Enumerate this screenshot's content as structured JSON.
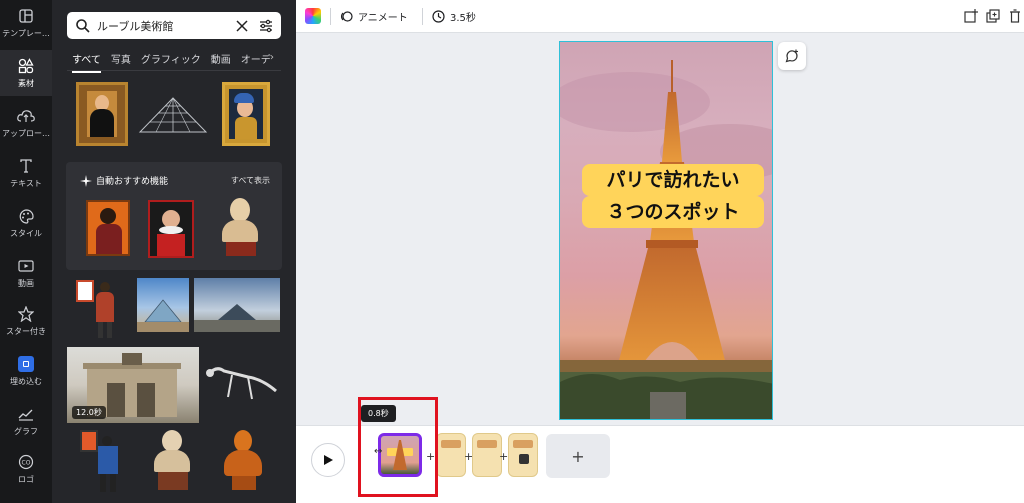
{
  "sidebar": {
    "items": [
      {
        "label": "テンプレー…",
        "icon": "template-icon"
      },
      {
        "label": "素材",
        "icon": "elements-icon"
      },
      {
        "label": "アップロー…",
        "icon": "upload-cloud-icon"
      },
      {
        "label": "テキスト",
        "icon": "text-icon"
      },
      {
        "label": "スタイル",
        "icon": "palette-icon"
      },
      {
        "label": "動画",
        "icon": "video-icon"
      },
      {
        "label": "スター付き",
        "icon": "star-icon"
      },
      {
        "label": "埋め込む",
        "icon": "embed-icon"
      },
      {
        "label": "グラフ",
        "icon": "chart-icon"
      },
      {
        "label": "ロゴ",
        "icon": "logo-icon"
      }
    ]
  },
  "panel": {
    "search_value": "ルーブル美術館",
    "tabs": [
      "すべて",
      "写真",
      "グラフィック",
      "動画",
      "オーデ"
    ],
    "auto_section": {
      "title": "自動おすすめ機能",
      "see_all": "すべて表示"
    },
    "video_badge": "12.0秒"
  },
  "toolbar": {
    "animate_label": "アニメート",
    "duration_label": "3.5秒"
  },
  "canvas": {
    "title_line1": "パリで訪れたい",
    "title_line2": "３つのスポット"
  },
  "timeline": {
    "tooltip": "0.8秒",
    "plus": "+",
    "add_label": "+"
  },
  "colors": {
    "accent_purple": "#7d2ae8",
    "highlight_red": "#e0121f",
    "title_yellow": "#ffd45a",
    "selection_cyan": "#2fc0d8"
  }
}
